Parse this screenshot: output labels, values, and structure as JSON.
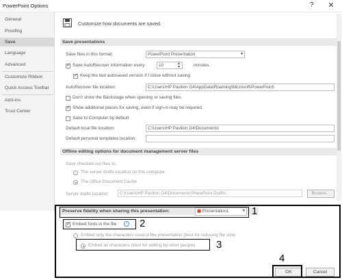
{
  "window": {
    "title": "PowerPoint Options",
    "help_glyph": "?",
    "close_glyph": "✕"
  },
  "sidebar": {
    "items": [
      {
        "label": "General",
        "selected": false
      },
      {
        "label": "Proofing",
        "selected": false
      },
      {
        "label": "Save",
        "selected": true
      },
      {
        "label": "Language",
        "selected": false
      },
      {
        "label": "Advanced",
        "selected": false
      },
      {
        "label": "Customize Ribbon",
        "selected": false
      },
      {
        "label": "Quick Access Toolbar",
        "selected": false
      },
      {
        "label": "Add-ins",
        "selected": false
      },
      {
        "label": "Trust Center",
        "selected": false
      }
    ]
  },
  "header": {
    "text": "Customize how documents are saved.",
    "icon": "floppy-disk-icon"
  },
  "save_presentations": {
    "title": "Save presentations",
    "format_label": "Save files in this format:",
    "format_value": "PowerPoint Presentation",
    "autorecover_label": "Save AutoRecover information every",
    "autorecover_minutes": "10",
    "minutes_label": "minutes",
    "keep_last_label": "Keep the last autosaved version if I close without saving",
    "autorecover_location_label": "AutoRecover file location:",
    "autorecover_location_value": "C:\\Users\\HP Pavilion G4\\AppData\\Roaming\\Microsoft\\PowerPoint\\",
    "backstage_label": "Don't show the Backstage when opening or saving files",
    "additional_places_label": "Show additional places for saving, even if sign-in may be required.",
    "save_to_computer_label": "Save to Computer by default",
    "default_local_label": "Default local file location:",
    "default_local_value": "C:\\Users\\HP Pavilion G4\\Documents\\",
    "default_templates_label": "Default personal templates location:",
    "default_templates_value": ""
  },
  "offline_editing": {
    "title": "Offline editing options for document management server files",
    "save_checked_out_label": "Save checked-out files to:",
    "server_drafts_option": "The server drafts location on this computer",
    "office_cache_option": "The Office Document Cache",
    "server_drafts_location_label": "Server drafts location:",
    "server_drafts_location_value": "C:\\Users\\HP Pavilion G4\\Documents\\SharePoint Drafts\\",
    "browse_label": "Browse..."
  },
  "fidelity": {
    "title": "Preserve fidelity when sharing this presentation:",
    "presentation_value": "Presentation1",
    "embed_fonts_label": "Embed fonts in the file",
    "embed_only_used_label": "Embed only the characters used in the presentation (best for reducing file size)",
    "embed_all_label": "Embed all characters (best for editing by other people)"
  },
  "footer": {
    "ok_label": "OK",
    "cancel_label": "Cancel"
  },
  "annotations": {
    "n1": "1",
    "n2": "2",
    "n3": "3",
    "n4": "4"
  }
}
